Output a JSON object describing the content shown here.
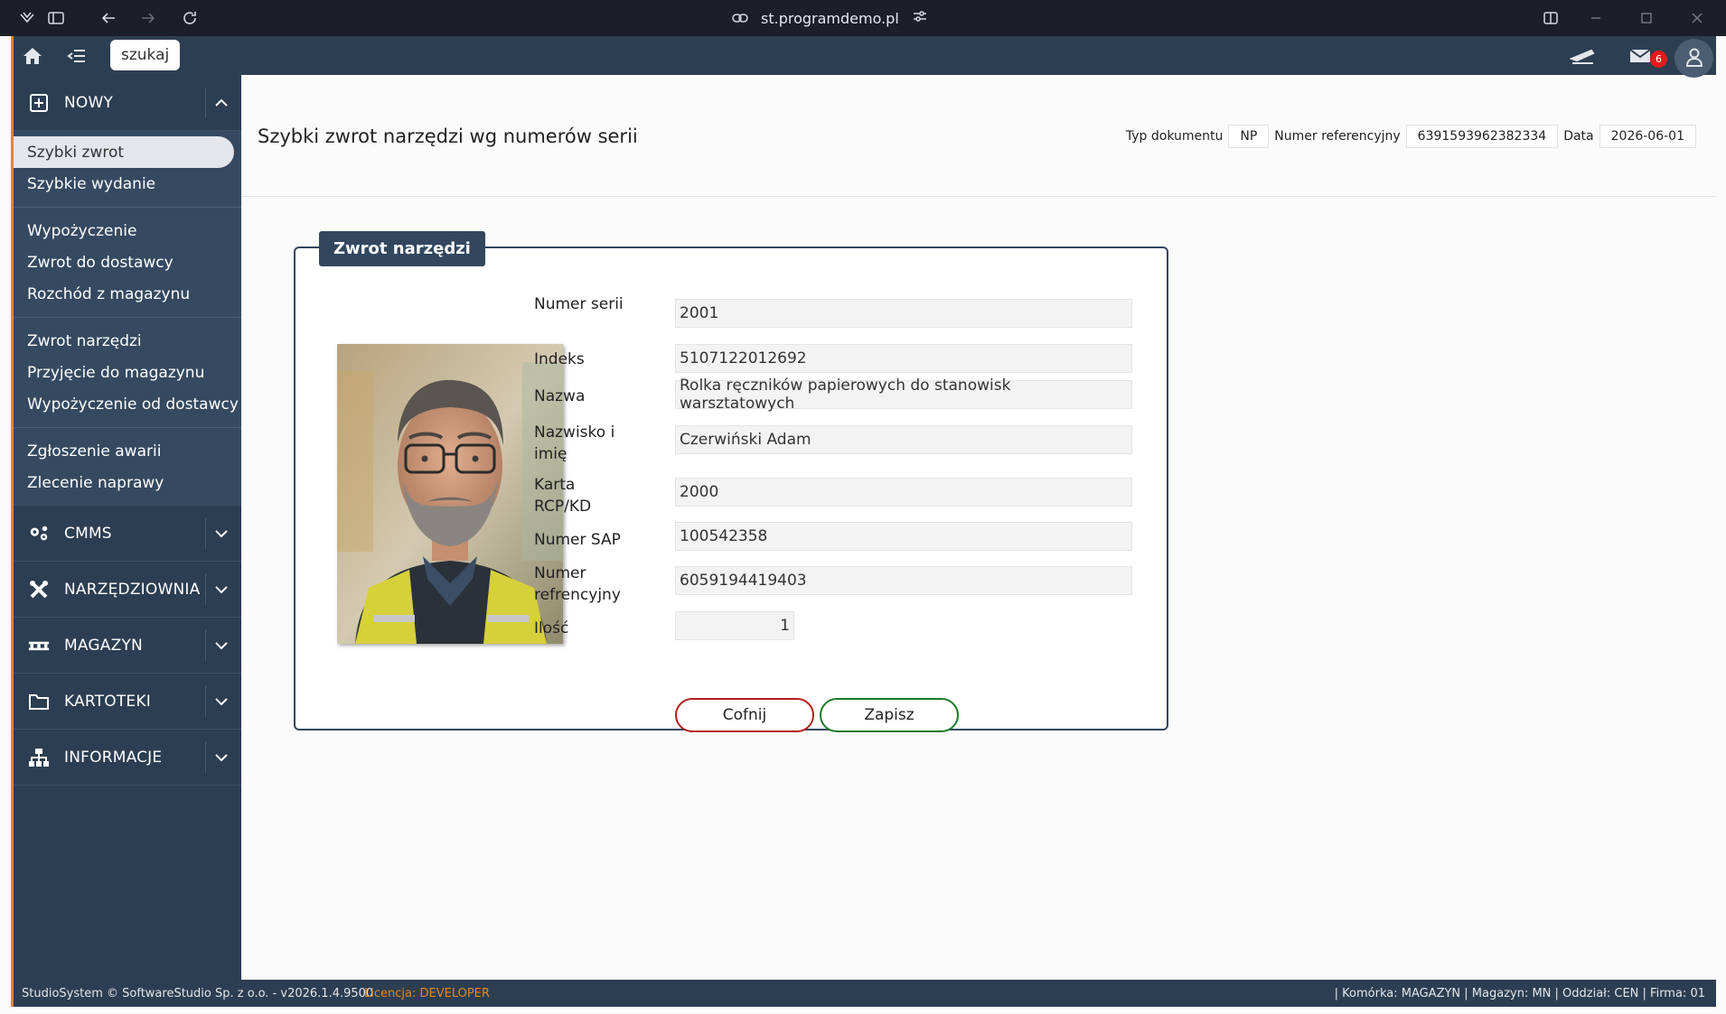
{
  "browser": {
    "url": "st.programdemo.pl"
  },
  "topbar": {
    "search_label": "szukaj",
    "mail_count": "6"
  },
  "sidebar": {
    "new_section": {
      "label": "NOWY",
      "items": [
        "Szybki zwrot",
        "Szybkie wydanie",
        "Wypożyczenie",
        "Zwrot do dostawcy",
        "Rozchód z magazynu",
        "Zwrot narzędzi",
        "Przyjęcie do magazynu",
        "Wypożyczenie od dostawcy",
        "Zgłoszenie awarii",
        "Zlecenie naprawy"
      ],
      "active_item": "Szybki zwrot"
    },
    "sections": [
      {
        "label": "CMMS",
        "icon": "gears-icon"
      },
      {
        "label": "NARZĘDZIOWNIA",
        "icon": "tools-icon"
      },
      {
        "label": "MAGAZYN",
        "icon": "pallet-icon"
      },
      {
        "label": "KARTOTEKI",
        "icon": "folder-icon"
      },
      {
        "label": "INFORMACJE",
        "icon": "sitemap-icon"
      }
    ]
  },
  "header": {
    "title": "Szybki zwrot narzędzi wg numerów serii",
    "doc_type_label": "Typ dokumentu",
    "doc_type_value": "NP",
    "ref_label": "Numer referencyjny",
    "ref_value": "6391593962382334",
    "date_label": "Data",
    "date_value": "2026-06-01"
  },
  "panel": {
    "legend": "Zwrot narzędzi",
    "fields": {
      "serial": {
        "label": "Numer serii",
        "value": "2001"
      },
      "index": {
        "label": "Indeks",
        "value": "5107122012692"
      },
      "name": {
        "label": "Nazwa",
        "value": "Rolka ręczników papierowych do stanowisk warsztatowych"
      },
      "person": {
        "label": "Nazwisko i imię",
        "value": "Czerwiński Adam"
      },
      "card": {
        "label": "Karta RCP/KD",
        "value": "2000"
      },
      "sap": {
        "label": "Numer SAP",
        "value": "100542358"
      },
      "ref": {
        "label": "Numer refrencyjny",
        "value": "6059194419403"
      },
      "qty": {
        "label": "Ilość",
        "value": "1"
      }
    },
    "cancel_label": "Cofnij",
    "save_label": "Zapisz"
  },
  "footer": {
    "left": "StudioSystem © SoftwareStudio Sp. z o.o. - v2026.1.4.9500",
    "license_label": "Licencja:",
    "license_value": "DEVELOPER",
    "right": "| Komórka: MAGAZYN | Magazyn: MN | Oddział: CEN | Firma: 01"
  },
  "colors": {
    "sidebar": "#2c3e52",
    "accent": "#e08a1e",
    "cancel": "#b51d1d",
    "save": "#1d7a2b",
    "badge": "#e21b1b"
  }
}
